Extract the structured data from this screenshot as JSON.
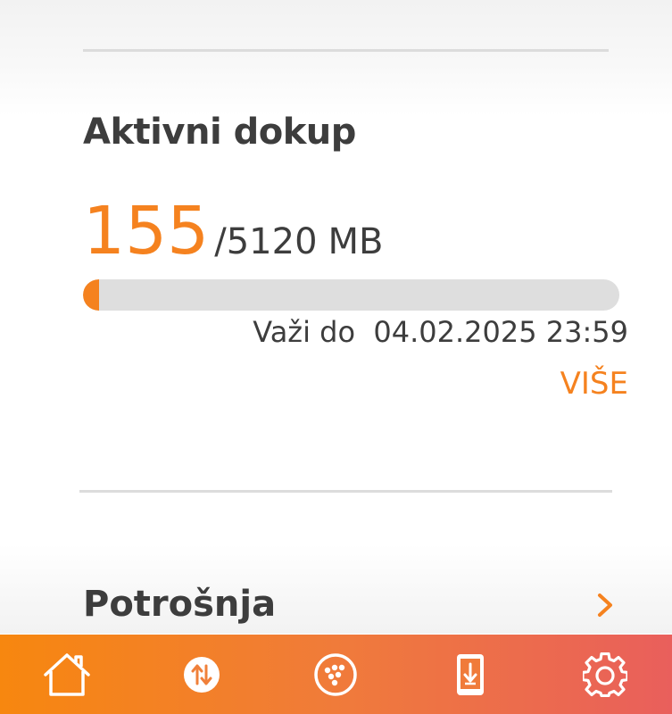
{
  "section": {
    "title": "Aktivni dokup"
  },
  "usage": {
    "used": "155",
    "separator": "/",
    "total": "5120",
    "unit": "MB",
    "used_fraction": 0.0303
  },
  "validity": {
    "label": "Važi do",
    "date": "04.02.2025 23:59"
  },
  "more_link": "VIŠE",
  "consumption": {
    "title": "Potrošnja"
  },
  "colors": {
    "accent": "#f5821f",
    "text": "#3d3d3d",
    "track": "#dedede",
    "nav_gradient_start": "#f7870f",
    "nav_gradient_end": "#e95f5c"
  },
  "bottom_nav": {
    "items": [
      {
        "icon": "home-icon"
      },
      {
        "icon": "transfer-icon"
      },
      {
        "icon": "operator-logo-icon"
      },
      {
        "icon": "phone-download-icon"
      },
      {
        "icon": "settings-gear-icon"
      }
    ]
  }
}
